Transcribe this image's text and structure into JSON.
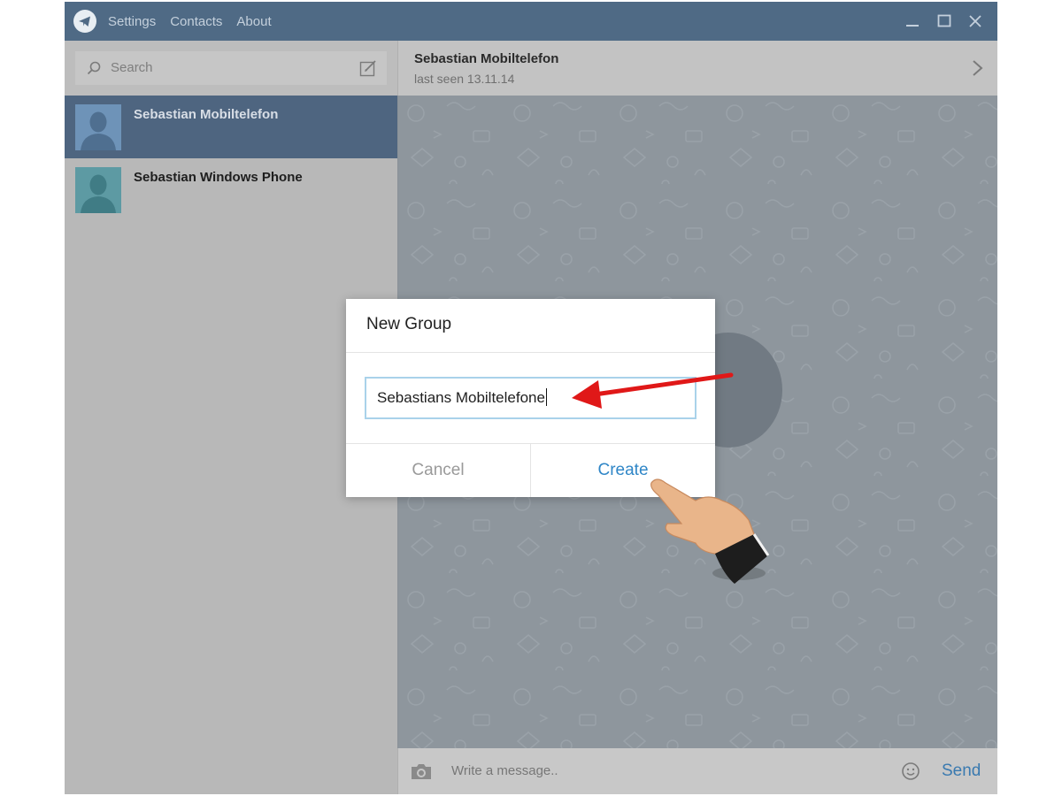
{
  "menu": {
    "settings": "Settings",
    "contacts": "Contacts",
    "about": "About"
  },
  "search": {
    "placeholder": "Search"
  },
  "contacts": [
    {
      "name": "Sebastian Mobiltelefon",
      "active": true
    },
    {
      "name": "Sebastian Windows Phone",
      "active": false
    }
  ],
  "chat": {
    "title": "Sebastian Mobiltelefon",
    "status": "last seen 13.11.14"
  },
  "composer": {
    "placeholder": "Write a message..",
    "send_label": "Send"
  },
  "dialog": {
    "title": "New Group",
    "group_name_value": "Sebastians Mobiltelefone",
    "cancel_label": "Cancel",
    "create_label": "Create"
  },
  "colors": {
    "titlebar": "#4f6a85",
    "active_contact": "#4e6580",
    "accent_blue": "#2f86c7",
    "input_border": "#a9d2ea",
    "annotation_arrow": "#e01818"
  },
  "icons": {
    "app_logo": "telegram-plane-icon",
    "search": "search-icon",
    "compose": "compose-icon",
    "chevron": "chevron-right-icon",
    "camera": "camera-icon",
    "emoji": "emoji-icon"
  }
}
